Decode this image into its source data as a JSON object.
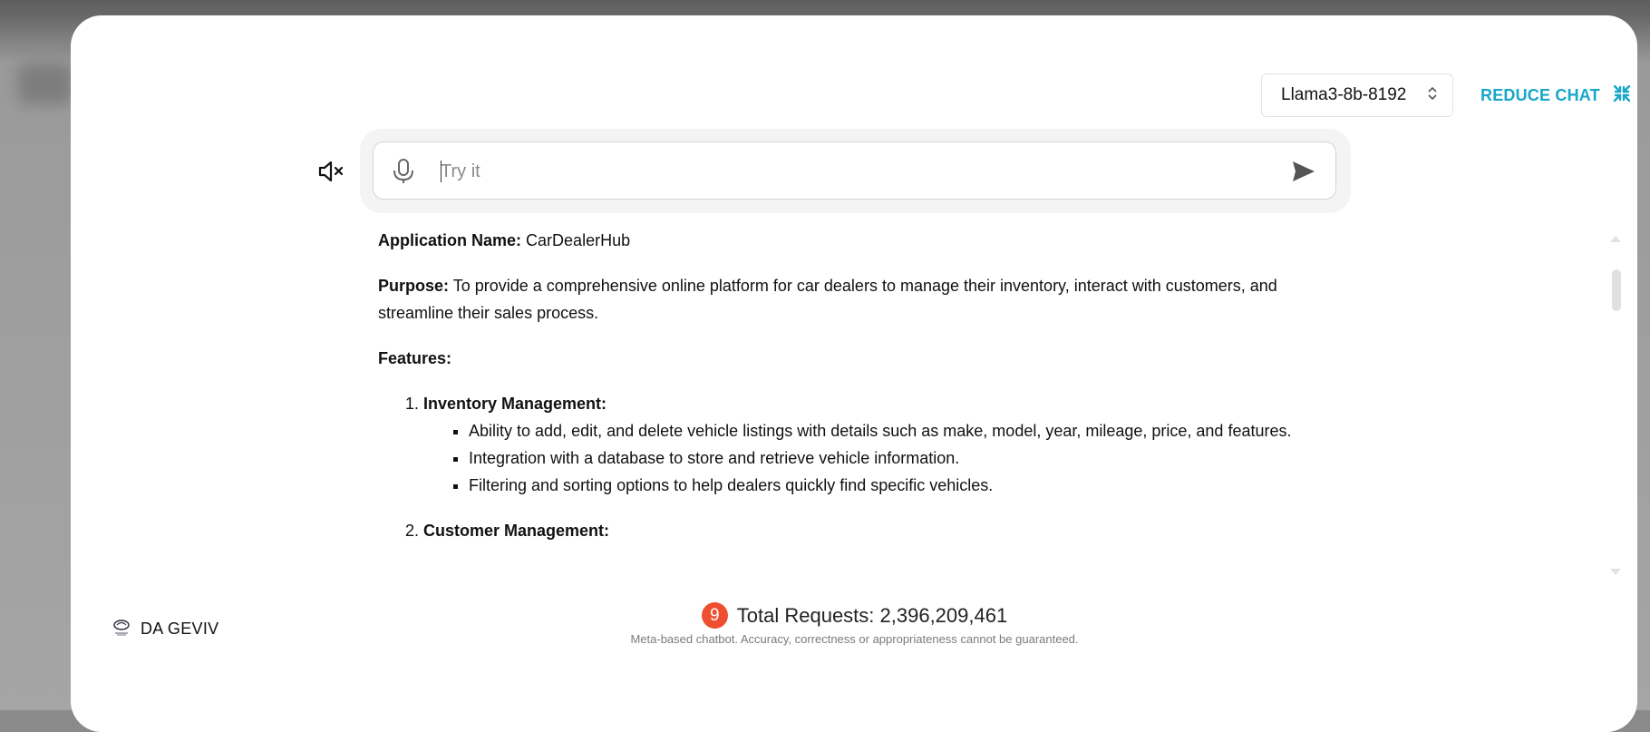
{
  "header": {
    "model_select": {
      "selected": "Llama3-8b-8192"
    },
    "reduce_chat_label": "REDUCE CHAT"
  },
  "input": {
    "placeholder": "Try it",
    "value": ""
  },
  "response": {
    "app_name_label": "Application Name:",
    "app_name_value": "CarDealerHub",
    "purpose_label": "Purpose:",
    "purpose_text": "To provide a comprehensive online platform for car dealers to manage their inventory, interact with customers, and streamline their sales process.",
    "features_label": "Features:",
    "features": [
      {
        "title": "Inventory Management:",
        "items": [
          "Ability to add, edit, and delete vehicle listings with details such as make, model, year, mileage, price, and features.",
          "Integration with a database to store and retrieve vehicle information.",
          "Filtering and sorting options to help dealers quickly find specific vehicles."
        ]
      },
      {
        "title": "Customer Management:",
        "items": []
      }
    ]
  },
  "footer": {
    "brand_name": "DA GEVIV",
    "badge_text": "9",
    "total_requests": "Total Requests: 2,396,209,461",
    "disclaimer": "Meta-based chatbot. Accuracy, correctness or appropriateness cannot be guaranteed."
  },
  "colors": {
    "accent": "#17a7c9",
    "badge": "#ee4f30"
  },
  "icons": {
    "mute": "volume-mute-icon",
    "mic": "microphone-icon",
    "send": "send-icon",
    "reduce": "collapse-icon",
    "select": "chevron-up-down-icon"
  }
}
